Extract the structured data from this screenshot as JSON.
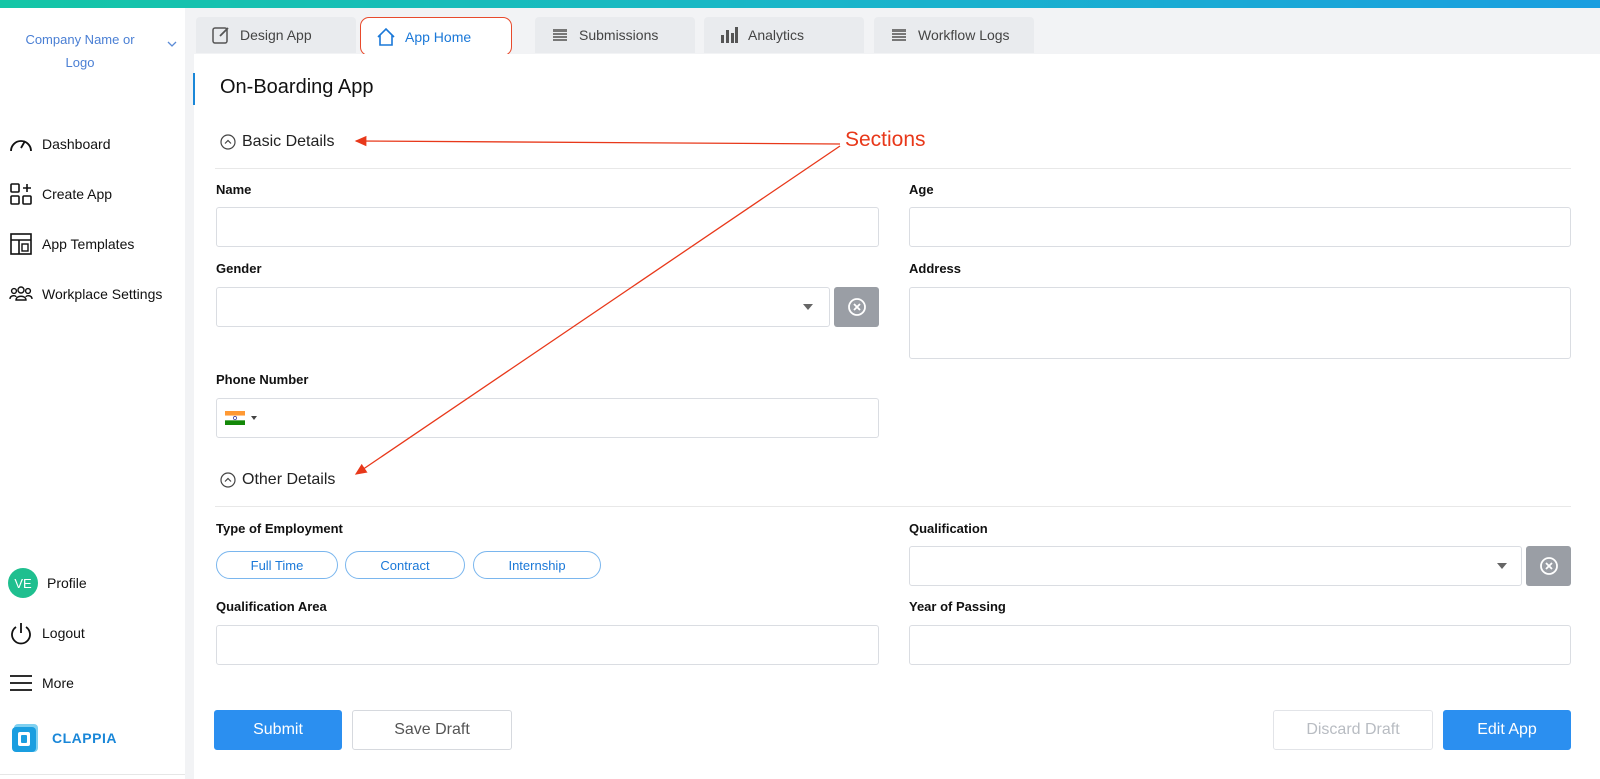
{
  "sidebar": {
    "company": "Company Name or Logo",
    "items": [
      {
        "label": "Dashboard"
      },
      {
        "label": "Create App"
      },
      {
        "label": "App Templates"
      },
      {
        "label": "Workplace Settings"
      }
    ],
    "bottom": [
      {
        "label": "Profile",
        "avatar": "VE"
      },
      {
        "label": "Logout"
      },
      {
        "label": "More"
      }
    ],
    "brand": "CLAPPIA"
  },
  "tabs": [
    {
      "label": "Design App",
      "icon": "edit-icon"
    },
    {
      "label": "App Home",
      "icon": "home-icon",
      "active": true
    },
    {
      "label": "Submissions",
      "icon": "table-icon"
    },
    {
      "label": "Analytics",
      "icon": "bar-chart-icon"
    },
    {
      "label": "Workflow Logs",
      "icon": "table-icon"
    }
  ],
  "page": {
    "title": "On-Boarding App",
    "sections": [
      {
        "title": "Basic Details"
      },
      {
        "title": "Other Details"
      }
    ],
    "fields": {
      "name": {
        "label": "Name",
        "value": ""
      },
      "age": {
        "label": "Age",
        "value": ""
      },
      "gender": {
        "label": "Gender",
        "value": ""
      },
      "address": {
        "label": "Address",
        "value": ""
      },
      "phone": {
        "label": "Phone Number",
        "value": ""
      },
      "employment": {
        "label": "Type of Employment",
        "options": [
          "Full Time",
          "Contract",
          "Internship"
        ]
      },
      "qualification": {
        "label": "Qualification",
        "value": ""
      },
      "qualification_area": {
        "label": "Qualification Area",
        "value": ""
      },
      "year_of_passing": {
        "label": "Year of Passing",
        "value": ""
      }
    }
  },
  "actions": {
    "submit": "Submit",
    "save_draft": "Save Draft",
    "discard_draft": "Discard Draft",
    "edit_app": "Edit App"
  },
  "annotation": {
    "text": "Sections",
    "color": "#e8381a"
  },
  "colors": {
    "accent": "#2b8ff0",
    "brand": "#1a87d8",
    "avatar": "#1fbf8f"
  }
}
